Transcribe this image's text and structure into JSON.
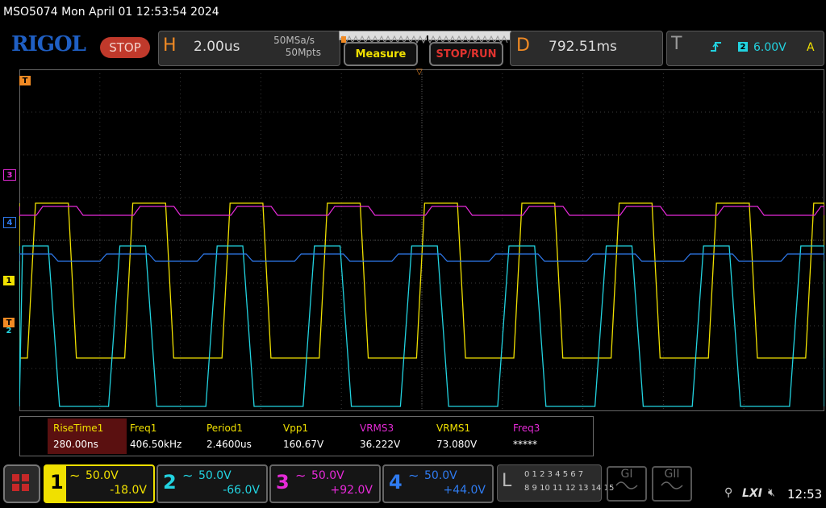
{
  "title_bar": "MSO5074  Mon April 01 12:53:54 2024",
  "logo": "RIGOL",
  "status_badge": "STOP",
  "horizontal": {
    "letter": "H",
    "timebase": "2.00us",
    "sample_rate": "50MSa/s",
    "memory_depth": "50Mpts"
  },
  "buttons": {
    "measure": "Measure",
    "stop_run": "STOP/RUN"
  },
  "delay": {
    "letter": "D",
    "value": "792.51ms"
  },
  "trigger": {
    "letter": "T",
    "channel": "2",
    "level": "6.00V",
    "mode": "A",
    "edge_icon": "rising-edge-icon"
  },
  "markers": {
    "trigger_top": "T",
    "ch3": "3",
    "ch4": "4",
    "ch1": "1",
    "ch2": "2",
    "trigger_level": "T"
  },
  "measurements": [
    {
      "label": "RiseTime1",
      "value": "280.00ns",
      "color": "#f0e000",
      "highlight": true
    },
    {
      "label": "Freq1",
      "value": "406.50kHz",
      "color": "#f0e000"
    },
    {
      "label": "Period1",
      "value": "2.4600us",
      "color": "#f0e000"
    },
    {
      "label": "Vpp1",
      "value": "160.67V",
      "color": "#f0e000"
    },
    {
      "label": "VRMS3",
      "value": "36.222V",
      "color": "#e62ad8"
    },
    {
      "label": "VRMS1",
      "value": "73.080V",
      "color": "#f0e000"
    },
    {
      "label": "Freq3",
      "value": "*****",
      "color": "#e62ad8"
    }
  ],
  "channels": [
    {
      "num": "1",
      "scale": "50.0V",
      "offset": "-18.0V",
      "color": "#f0e000",
      "coupling_icon": "ac-coupling-icon"
    },
    {
      "num": "2",
      "scale": "50.0V",
      "offset": "-66.0V",
      "color": "#22d3e0",
      "coupling_icon": "ac-coupling-icon"
    },
    {
      "num": "3",
      "scale": "50.0V",
      "offset": "+92.0V",
      "color": "#e62ad8",
      "coupling_icon": "ac-coupling-icon"
    },
    {
      "num": "4",
      "scale": "50.0V",
      "offset": "+44.0V",
      "color": "#2f7bf0",
      "coupling_icon": "ac-coupling-icon"
    }
  ],
  "logic": {
    "letter": "L",
    "row1": "0 1 2 3  4 5 6 7",
    "row2": "8 9 10 11 12 13 14 15"
  },
  "generators": {
    "g1": "GI",
    "g2": "GII"
  },
  "status_area": {
    "lxi": "LXI",
    "time": "12:53"
  },
  "colors": {
    "ch1": "#f0e000",
    "ch2": "#22d3e0",
    "ch3": "#e62ad8",
    "ch4": "#2f7bf0",
    "accent": "#f08a24"
  }
}
